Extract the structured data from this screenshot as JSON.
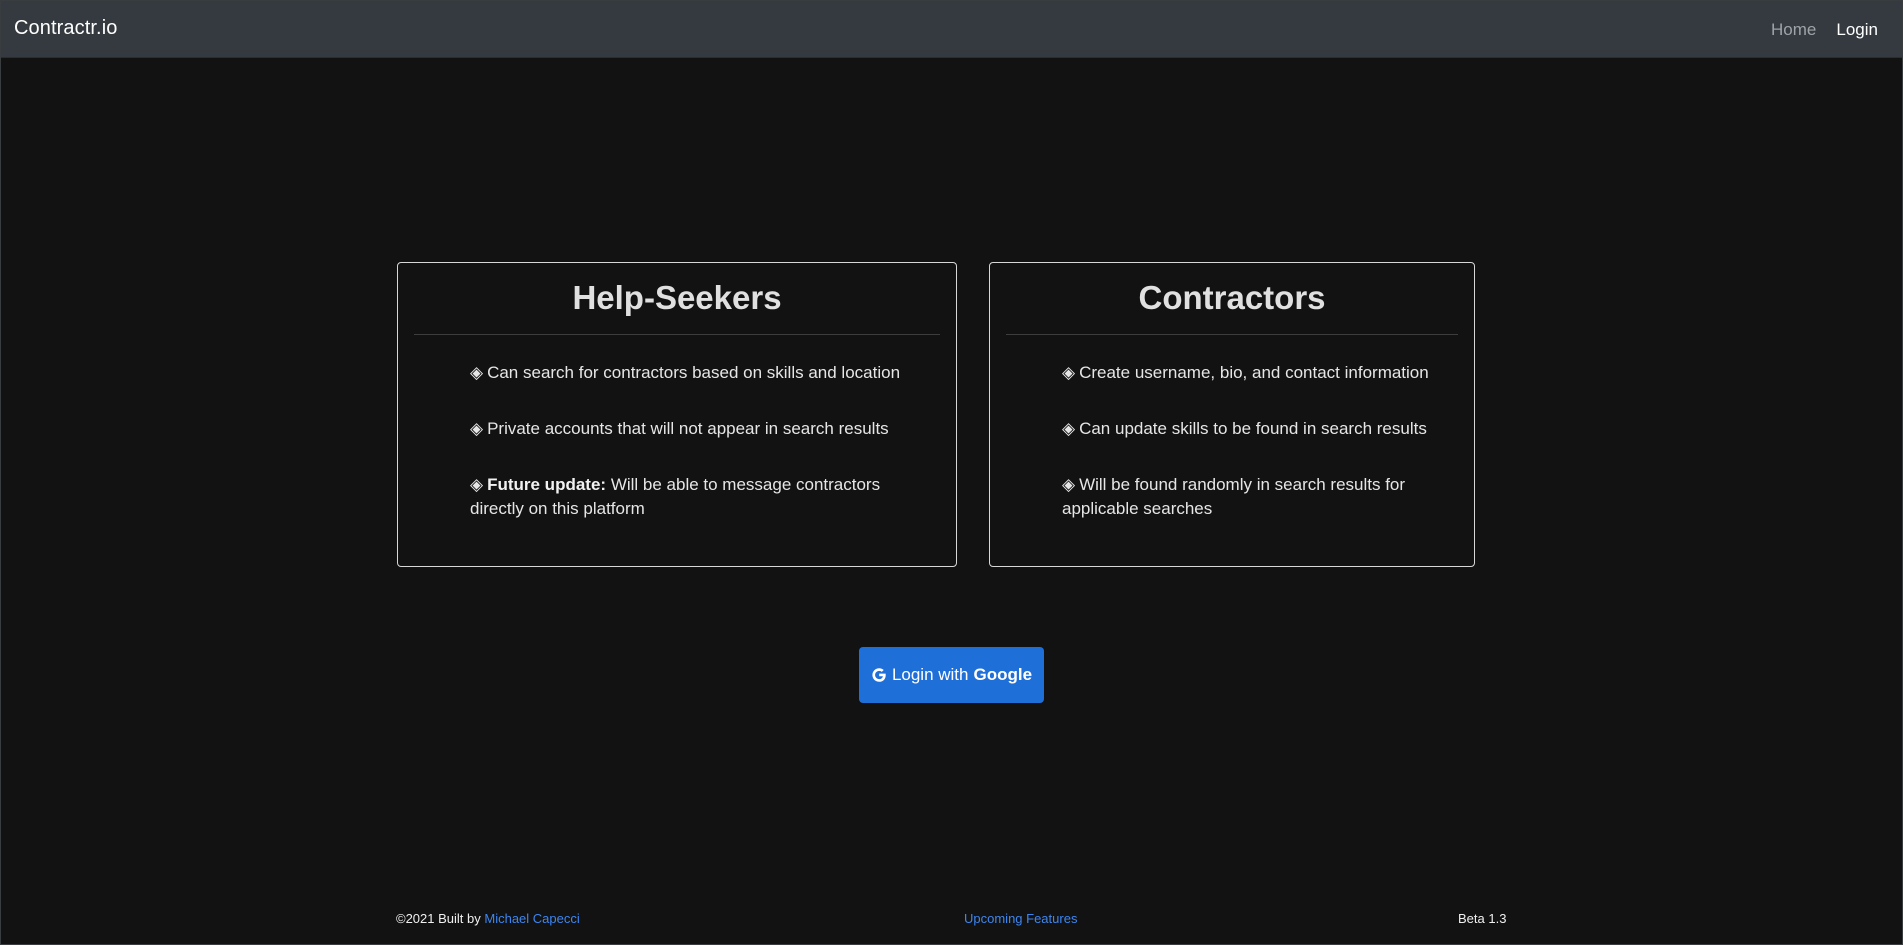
{
  "navbar": {
    "brand": "Contractr.io",
    "links": [
      {
        "label": "Home",
        "active": false
      },
      {
        "label": "Login",
        "active": true
      }
    ]
  },
  "cards": [
    {
      "title": "Help-Seekers",
      "items": [
        {
          "bullet": "◈",
          "bold": "",
          "text": "Can search for contractors based on skills and location"
        },
        {
          "bullet": "◈",
          "bold": "",
          "text": "Private accounts that will not appear in search results"
        },
        {
          "bullet": "◈",
          "bold": "Future update:",
          "text": "Will be able to message contractors directly on this platform"
        }
      ]
    },
    {
      "title": "Contractors",
      "items": [
        {
          "bullet": "◈",
          "bold": "",
          "text": "Create username, bio, and contact information"
        },
        {
          "bullet": "◈",
          "bold": "",
          "text": "Can update skills to be found in search results"
        },
        {
          "bullet": "◈",
          "bold": "",
          "text": "Will be found randomly in search results for applicable searches"
        }
      ]
    }
  ],
  "login_button": {
    "prefix": "Login with",
    "provider": "Google",
    "icon": "google-g-icon"
  },
  "footer": {
    "copyright": "©2021 Built by",
    "author_link": "Michael Capecci",
    "upcoming_link": "Upcoming Features",
    "version": "Beta 1.3"
  },
  "colors": {
    "background": "#121212",
    "navbar": "#343a40",
    "button": "#1f6fd8",
    "link": "#3d86f0"
  }
}
